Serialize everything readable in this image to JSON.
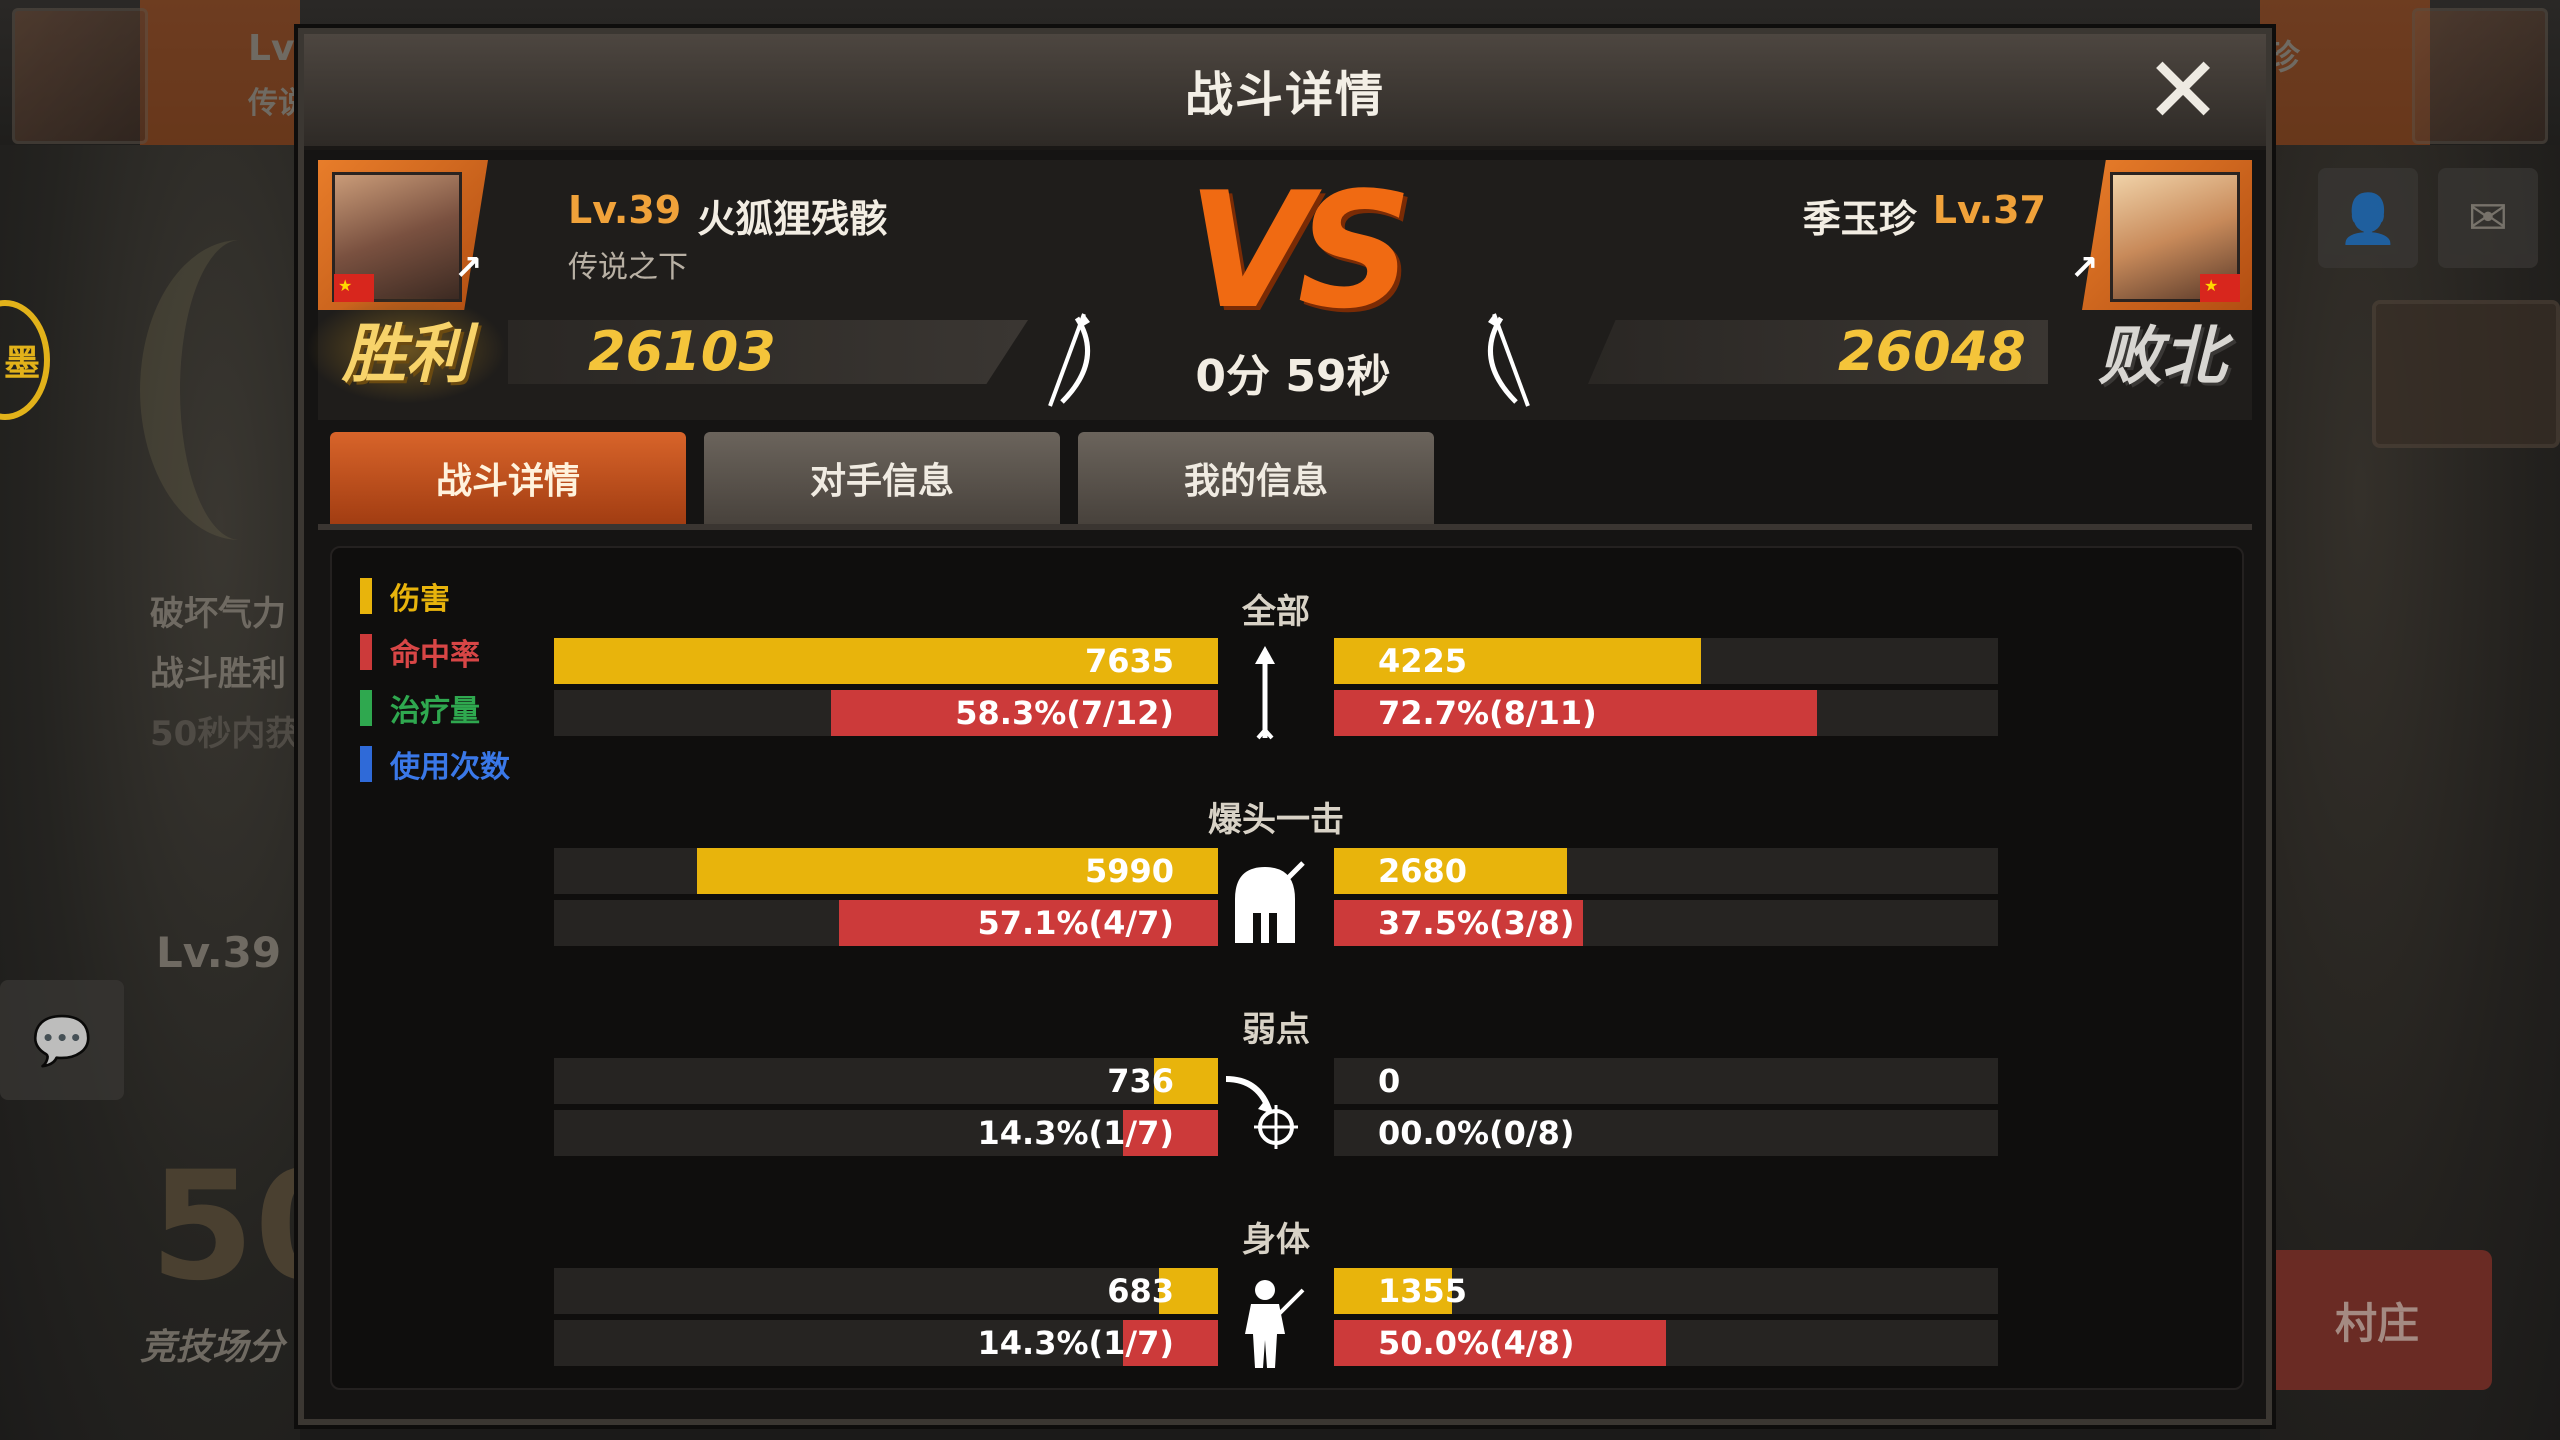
{
  "background": {
    "left_level_label": "Lv",
    "left_sub_label": "传说",
    "right_name_fragment": "珍",
    "left_menu": [
      "破坏气力",
      "战斗胜利",
      "50秒内获"
    ],
    "left_level": "Lv.39",
    "left_big_number": "50",
    "left_caption": "竞技场分",
    "left_seal": "墨",
    "right_button": "村庄"
  },
  "modal": {
    "title": "战斗详情",
    "close_icon": "close-x-icon"
  },
  "player": {
    "level": "Lv.39",
    "name": "火狐狸残骸",
    "title": "传说之下",
    "score": "26103",
    "result": "胜利"
  },
  "opponent": {
    "level": "Lv.37",
    "name": "季玉珍",
    "score": "26048",
    "result": "败北"
  },
  "battle": {
    "vs": "VS",
    "time": "0分 59秒"
  },
  "tabs": [
    {
      "label": "战斗详情",
      "active": true
    },
    {
      "label": "对手信息",
      "active": false
    },
    {
      "label": "我的信息",
      "active": false
    }
  ],
  "legend": [
    {
      "label": "伤害",
      "color": "#e8b40c"
    },
    {
      "label": "命中率",
      "color": "#cc3a3a"
    },
    {
      "label": "治疗量",
      "color": "#2fa84f"
    },
    {
      "label": "使用次数",
      "color": "#2f6ad8"
    }
  ],
  "sections": [
    {
      "title": "全部",
      "icon": "arrow-icon",
      "left_damage": "7635",
      "left_damage_ratio": 1.0,
      "left_hit": "58.3%(7/12)",
      "left_hit_ratio": 0.583,
      "right_damage": "4225",
      "right_damage_ratio": 0.553,
      "right_hit": "72.7%(8/11)",
      "right_hit_ratio": 0.727
    },
    {
      "title": "爆头一击",
      "icon": "helmet-icon",
      "left_damage": "5990",
      "left_damage_ratio": 0.785,
      "left_hit": "57.1%(4/7)",
      "left_hit_ratio": 0.571,
      "right_damage": "2680",
      "right_damage_ratio": 0.351,
      "right_hit": "37.5%(3/8)",
      "right_hit_ratio": 0.375
    },
    {
      "title": "弱点",
      "icon": "weakpoint-target-icon",
      "left_damage": "736",
      "left_damage_ratio": 0.096,
      "left_hit": "14.3%(1/7)",
      "left_hit_ratio": 0.143,
      "right_damage": "0",
      "right_damage_ratio": 0.0,
      "right_hit": "00.0%(0/8)",
      "right_hit_ratio": 0.0
    },
    {
      "title": "身体",
      "icon": "body-hit-icon",
      "left_damage": "683",
      "left_damage_ratio": 0.089,
      "left_hit": "14.3%(1/7)",
      "left_hit_ratio": 0.143,
      "right_damage": "1355",
      "right_damage_ratio": 0.177,
      "right_hit": "50.0%(4/8)",
      "right_hit_ratio": 0.5
    }
  ]
}
